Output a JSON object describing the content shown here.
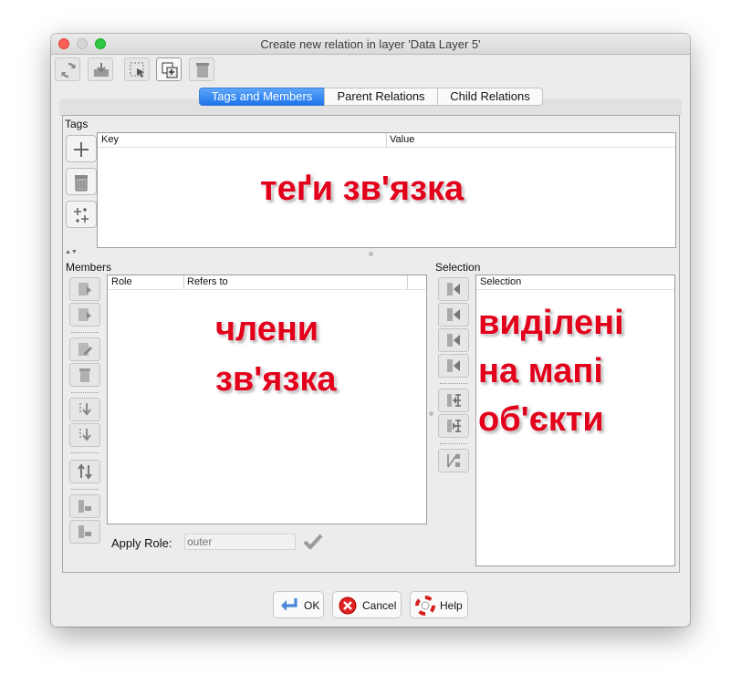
{
  "window": {
    "title": "Create new relation in layer 'Data Layer 5'"
  },
  "toolbar": {
    "buttons": [
      {
        "icon": "refresh-icon"
      },
      {
        "icon": "download-icon"
      },
      {
        "icon": "select-icon"
      },
      {
        "icon": "duplicate-icon"
      },
      {
        "icon": "delete-icon"
      }
    ]
  },
  "tabs": [
    {
      "label": "Tags and Members",
      "selected": true
    },
    {
      "label": "Parent Relations",
      "selected": false
    },
    {
      "label": "Child Relations",
      "selected": false
    }
  ],
  "tags": {
    "section_label": "Tags",
    "columns": {
      "key": "Key",
      "value": "Value"
    },
    "overlay": "теґи зв'язка",
    "buttons": [
      "add-icon",
      "trash-icon",
      "paste-tags-icon"
    ]
  },
  "members": {
    "section_label": "Members",
    "columns": {
      "role": "Role",
      "refers_to": "Refers to"
    },
    "overlay_line1": "члени",
    "overlay_line2": "зв'язка",
    "apply_role_label": "Apply Role:",
    "apply_role_placeholder": "outer"
  },
  "selection": {
    "section_label": "Selection",
    "column": "Selection",
    "overlay_line1": "виділені",
    "overlay_line2": "на мапі",
    "overlay_line3": "об'єкти"
  },
  "footer": {
    "ok_label": "OK",
    "cancel_label": "Cancel",
    "help_label": "Help"
  },
  "colors": {
    "accent": "#1f75ec",
    "overlay_text": "#e3001b"
  }
}
